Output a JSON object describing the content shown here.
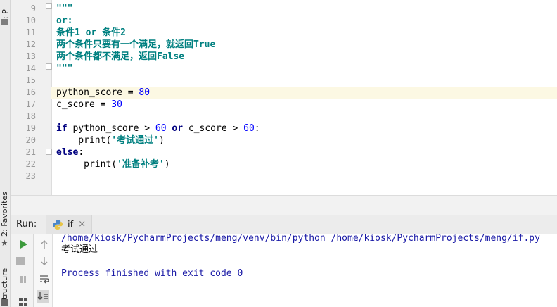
{
  "tool_stripe": {
    "project_tab": "1: P",
    "favorites_tab": "2: Favorites",
    "structure_tab": "Structure"
  },
  "editor": {
    "line_numbers": [
      "9",
      "10",
      "11",
      "12",
      "13",
      "14",
      "15",
      "16",
      "17",
      "18",
      "19",
      "20",
      "21",
      "22",
      "23"
    ],
    "lines": [
      {
        "parts": [
          {
            "t": "\"\"\"",
            "c": "str"
          }
        ]
      },
      {
        "parts": [
          {
            "t": "or:",
            "c": "str"
          }
        ]
      },
      {
        "parts": [
          {
            "t": "条件1 or 条件2",
            "c": "str"
          }
        ]
      },
      {
        "parts": [
          {
            "t": "两个条件只要有一个满足，就返回True",
            "c": "str"
          }
        ]
      },
      {
        "parts": [
          {
            "t": "两个条件都不满足，返回False",
            "c": "str"
          }
        ]
      },
      {
        "parts": [
          {
            "t": "\"\"\"",
            "c": "str"
          }
        ]
      },
      {
        "parts": []
      },
      {
        "parts": [
          {
            "t": "python_score = ",
            "c": ""
          },
          {
            "t": "80",
            "c": "num"
          }
        ]
      },
      {
        "parts": [
          {
            "t": "c_score = ",
            "c": ""
          },
          {
            "t": "30",
            "c": "num"
          }
        ]
      },
      {
        "parts": []
      },
      {
        "parts": [
          {
            "t": "if",
            "c": "kw"
          },
          {
            "t": " python_score > ",
            "c": ""
          },
          {
            "t": "60",
            "c": "num"
          },
          {
            "t": " ",
            "c": ""
          },
          {
            "t": "or",
            "c": "kw"
          },
          {
            "t": " c_score > ",
            "c": ""
          },
          {
            "t": "60",
            "c": "num"
          },
          {
            "t": ":",
            "c": ""
          }
        ]
      },
      {
        "parts": [
          {
            "t": "    print(",
            "c": ""
          },
          {
            "t": "'考试通过'",
            "c": "str"
          },
          {
            "t": ")",
            "c": ""
          }
        ]
      },
      {
        "parts": [
          {
            "t": "else",
            "c": "kw"
          },
          {
            "t": ":",
            "c": ""
          }
        ]
      },
      {
        "parts": [
          {
            "t": "     print(",
            "c": ""
          },
          {
            "t": "'准备补考'",
            "c": "str"
          },
          {
            "t": ")",
            "c": ""
          }
        ]
      },
      {
        "parts": []
      }
    ],
    "highlighted_line_index": 7
  },
  "run_panel": {
    "label": "Run:",
    "tab_name": "if",
    "close_glyph": "×",
    "console": {
      "command": "/home/kiosk/PycharmProjects/meng/venv/bin/python /home/kiosk/PycharmProjects/meng/if.py",
      "output": "考试通过",
      "finished": "Process finished with exit code 0"
    }
  },
  "icons": [
    "python-file-icon",
    "run-icon",
    "stop-icon",
    "pause-icon",
    "up-arrow-icon",
    "down-arrow-icon",
    "soft-wrap-icon",
    "scroll-to-end-icon",
    "layout-icon",
    "favorites-star-icon"
  ],
  "colors": {
    "string": "#008080",
    "keyword": "#000080",
    "number": "#0000ff",
    "console_text": "#1a1aa6",
    "caret_line": "#fcf8e3",
    "run_green": "#3c9a3c"
  }
}
